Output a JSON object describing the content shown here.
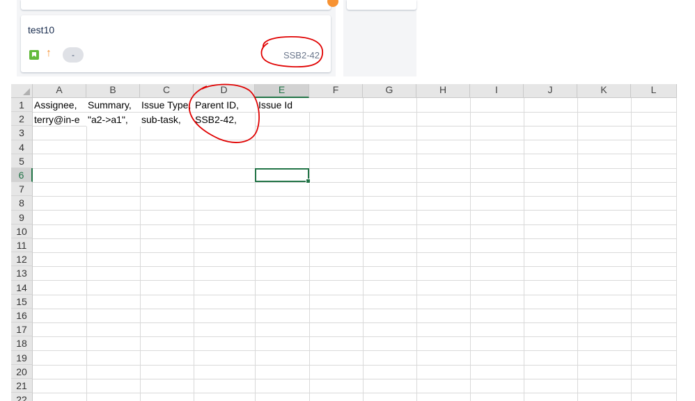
{
  "board": {
    "card_title": "test10",
    "estimate": "-",
    "issue_key": "SSB2-42",
    "colors": {
      "story": "#63ba3c",
      "priority": "#f79232",
      "avatar": "#f79232"
    }
  },
  "sheet": {
    "columns": [
      "A",
      "B",
      "C",
      "D",
      "E",
      "F",
      "G",
      "H",
      "I",
      "J",
      "K",
      "L"
    ],
    "rows": [
      "1",
      "2",
      "3",
      "4",
      "5",
      "6",
      "7",
      "8",
      "9",
      "10",
      "11",
      "12",
      "13",
      "14",
      "15",
      "16",
      "17",
      "18",
      "19",
      "20",
      "21",
      "22"
    ],
    "selected_col": "E",
    "selected_row": "6",
    "cells": {
      "A1": "Assignee,",
      "B1": "Summary,",
      "C1": "Issue Type,",
      "D1": "Parent ID,",
      "E1": "Issue Id",
      "A2": "terry@in-e",
      "B2": "\"a2->a1\",",
      "C2": "sub-task,",
      "D2": "SSB2-42,"
    },
    "accent": "#217346"
  },
  "annotations": {
    "color": "#e00000"
  }
}
